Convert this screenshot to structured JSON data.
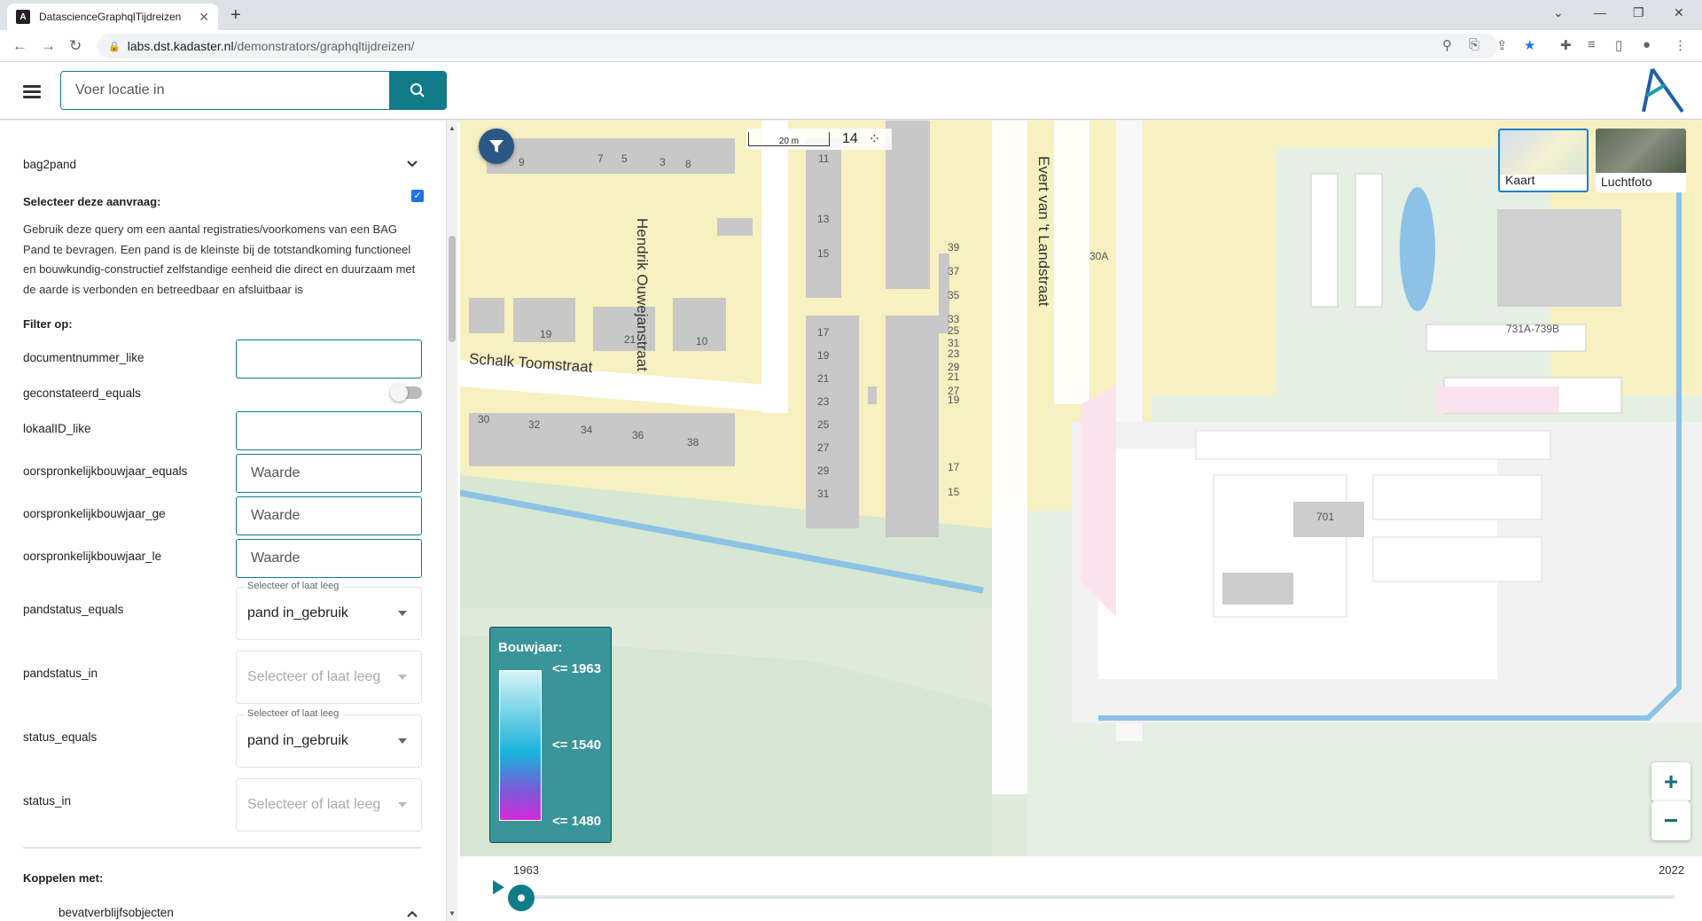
{
  "browser": {
    "tab_title": "DatascienceGraphqlTijdreizen",
    "tab_favicon": "A",
    "url_host": "labs.dst.kadaster.nl",
    "url_path": "/demonstrators/graphqltijdreizen/"
  },
  "header": {
    "search_placeholder": "Voer locatie in"
  },
  "sidebar": {
    "query_name": "bag2pand",
    "select_label": "Selecteer deze aanvraag:",
    "description": "Gebruik deze query om een aantal registraties/voorkomens van een BAG Pand te bevragen. Een pand is de kleinste bij de totstandkoming functioneel en bouwkundig-constructief zelfstandige eenheid die direct en duurzaam met de aarde is verbonden en betreedbaar en afsluitbaar is",
    "filter_heading": "Filter op:",
    "filters": {
      "documentnummer_like": {
        "label": "documentnummer_like",
        "value": ""
      },
      "geconstateerd_equals": {
        "label": "geconstateerd_equals"
      },
      "lokaalID_like": {
        "label": "lokaalID_like",
        "value": ""
      },
      "bouwjaar_equals": {
        "label": "oorspronkelijkbouwjaar_equals",
        "placeholder": "Waarde"
      },
      "bouwjaar_ge": {
        "label": "oorspronkelijkbouwjaar_ge",
        "placeholder": "Waarde"
      },
      "bouwjaar_le": {
        "label": "oorspronkelijkbouwjaar_le",
        "placeholder": "Waarde"
      },
      "pandstatus_equals": {
        "label": "pandstatus_equals",
        "float_label": "Selecteer of laat leeg",
        "value": "pand in_gebruik"
      },
      "pandstatus_in": {
        "label": "pandstatus_in",
        "placeholder": "Selecteer of laat leeg"
      },
      "status_equals": {
        "label": "status_equals",
        "float_label": "Selecteer of laat leeg",
        "value": "pand in_gebruik"
      },
      "status_in": {
        "label": "status_in",
        "placeholder": "Selecteer of laat leeg"
      }
    },
    "link_heading": "Koppelen met:",
    "link_item": "bevatverblijfsobjecten"
  },
  "map": {
    "scale_label": "20 m",
    "zoom_level": "14",
    "streets": [
      "Schalk Toomstraat",
      "Hendrik Ouwejanstraat",
      "Evert van 't Landstraat"
    ],
    "house_numbers": [
      "9",
      "7",
      "5",
      "3",
      "8",
      "11",
      "39",
      "37",
      "35",
      "33",
      "31",
      "29",
      "27",
      "11",
      "13",
      "15",
      "30A",
      "731A-739B",
      "19",
      "21",
      "10",
      "17",
      "19",
      "21",
      "23",
      "25",
      "27",
      "29",
      "31",
      "25",
      "23",
      "21",
      "19",
      "17",
      "15",
      "30",
      "32",
      "34",
      "36",
      "38",
      "701"
    ],
    "basemaps": [
      {
        "label": "Kaart"
      },
      {
        "label": "Luchtfoto"
      }
    ],
    "legend": {
      "title": "Bouwjaar:",
      "values": [
        "<= 1963",
        "<= 1540",
        "<= 1480"
      ]
    },
    "zoom_in": "+",
    "zoom_out": "−"
  },
  "timeline": {
    "start_year": "1963",
    "end_year": "2022",
    "progress": 0
  },
  "colors": {
    "accent": "#117b8a",
    "residential": "#f7f0c0",
    "green": "#d6e6d2",
    "building": "#cdcdcd",
    "water": "#8cc2e6"
  }
}
